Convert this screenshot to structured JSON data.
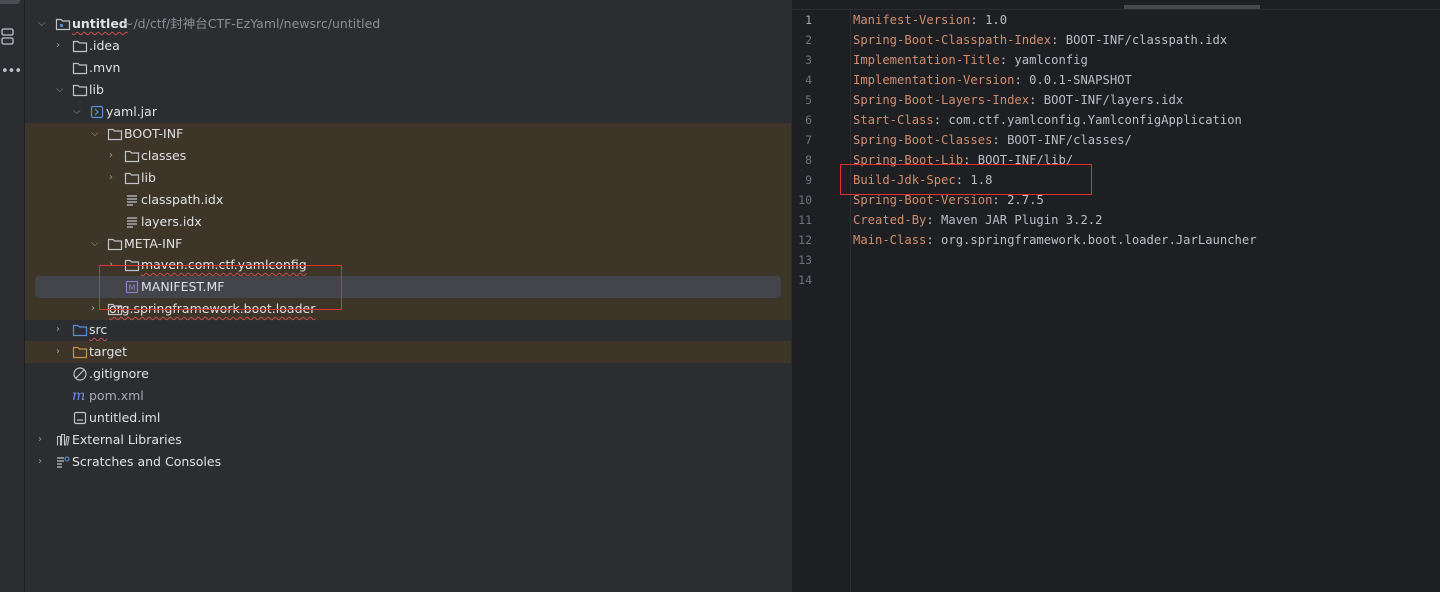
{
  "colors": {
    "panel_bg": "#2b2d30",
    "editor_bg": "#1e1f22",
    "key_color": "#cf8e6d",
    "value_color": "#bcbec4",
    "highlight_row": "#3c3528",
    "selected_row": "#43454a",
    "annotation": "#e03030"
  },
  "tree": {
    "root": {
      "label": "untitled",
      "path": "~/d/ctf/封神台CTF-EzYaml/newsrc/untitled"
    },
    "idea": ".idea",
    "mvn": ".mvn",
    "lib": "lib",
    "yaml_jar": "yaml.jar",
    "boot_inf": "BOOT-INF",
    "classes": "classes",
    "boot_lib": "lib",
    "classpath_idx": "classpath.idx",
    "layers_idx": "layers.idx",
    "meta_inf": "META-INF",
    "maven_pkg": "maven.com.ctf.yamlconfig",
    "manifest": "MANIFEST.MF",
    "loader_pkg": "org.springframework.boot.loader",
    "src": "src",
    "target": "target",
    "gitignore": ".gitignore",
    "pom": "pom.xml",
    "iml": "untitled.iml",
    "external_libraries": "External Libraries",
    "scratches": "Scratches and Consoles"
  },
  "editor": {
    "line_numbers": [
      "1",
      "2",
      "3",
      "4",
      "5",
      "6",
      "7",
      "8",
      "9",
      "10",
      "11",
      "12",
      "13",
      "14"
    ],
    "lines": [
      {
        "key": "Manifest-Version",
        "value": ": 1.0"
      },
      {
        "key": "Spring-Boot-Classpath-Index",
        "value": ": BOOT-INF/classpath.idx"
      },
      {
        "key": "Implementation-Title",
        "value": ": yamlconfig"
      },
      {
        "key": "Implementation-Version",
        "value": ": 0.0.1-SNAPSHOT"
      },
      {
        "key": "Spring-Boot-Layers-Index",
        "value": ": BOOT-INF/layers.idx"
      },
      {
        "key": "Start-Class",
        "value": ": com.ctf.yamlconfig.YamlconfigApplication"
      },
      {
        "key": "Spring-Boot-Classes",
        "value": ": BOOT-INF/classes/"
      },
      {
        "key": "Spring-Boot-Lib",
        "value": ": BOOT-INF/lib/"
      },
      {
        "key": "Build-Jdk-Spec",
        "value": ": 1.8"
      },
      {
        "key": "Spring-Boot-Version",
        "value": ": 2.7.5"
      },
      {
        "key": "Created-By",
        "value": ": Maven JAR Plugin 3.2.2"
      },
      {
        "key": "Main-Class",
        "value": ": org.springframework.boot.loader.JarLauncher"
      }
    ]
  }
}
